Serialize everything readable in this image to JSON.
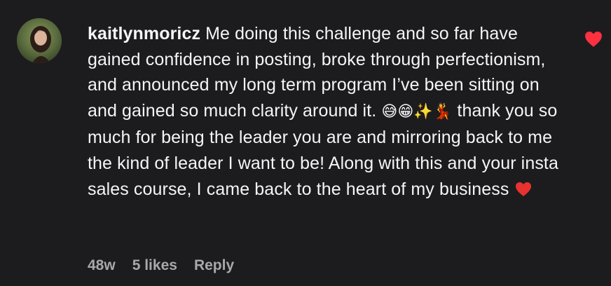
{
  "comment": {
    "username": "kaitlynmoricz",
    "text_part1": " Me doing this challenge and so far have gained confidence in posting, broke through perfectionism, and announced my long term program I’ve been sitting on and gained so much clarity around it. ",
    "emojis": "😅😁✨💃",
    "text_part2": " thank you so much for being the leader you are and mirroring back to me the kind of leader I want to be! Along with this and your insta sales course, I came back to the heart of my business ",
    "liked": true,
    "like_color": "#ff3040",
    "inline_heart_color": "#e8322f",
    "icon_like": "heart-icon",
    "icon_inline": "red-heart-emoji-icon"
  },
  "footer": {
    "time": "48w",
    "likes": "5 likes",
    "reply": "Reply"
  }
}
